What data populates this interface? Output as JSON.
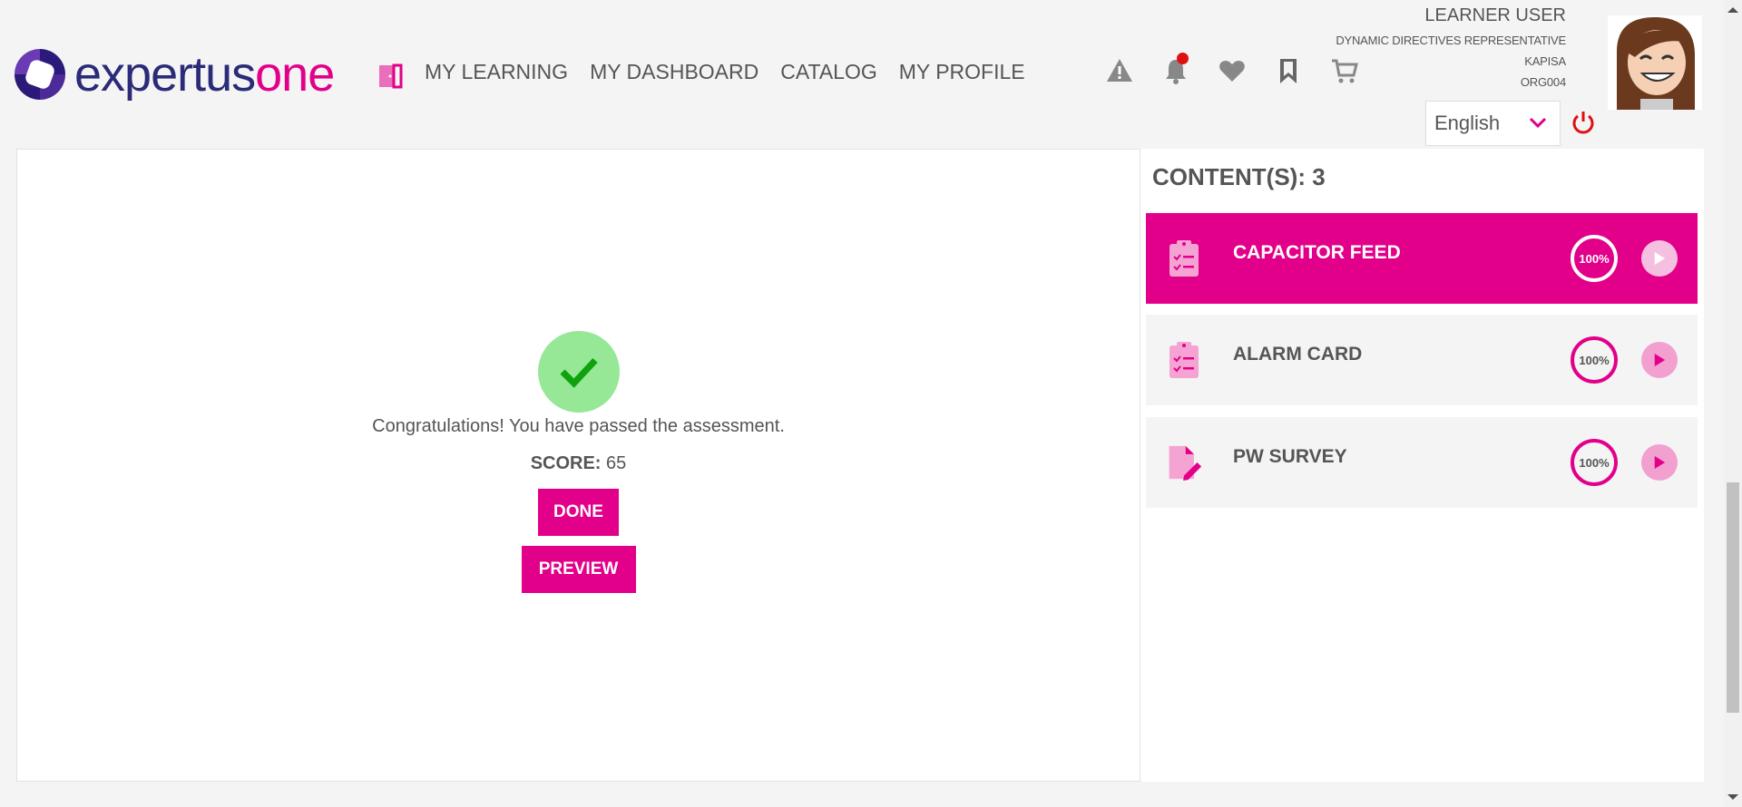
{
  "brand": {
    "logo_part1": "expertus",
    "logo_part2": "one",
    "accent_color": "#e2008a"
  },
  "nav": {
    "items": [
      {
        "label": "MY LEARNING"
      },
      {
        "label": "MY DASHBOARD"
      },
      {
        "label": "CATALOG"
      },
      {
        "label": "MY PROFILE"
      }
    ]
  },
  "header_icons": [
    "alert-icon",
    "bell-icon",
    "heart-icon",
    "bookmark-icon",
    "cart-icon"
  ],
  "user": {
    "name": "LEARNER USER",
    "role": "DYNAMIC DIRECTIVES REPRESENTATIVE",
    "org_name": "KAPISA",
    "org_code": "ORG004"
  },
  "language": {
    "selected": "English"
  },
  "assessment": {
    "message": "Congratulations! You have passed the assessment.",
    "score_label": "SCORE:",
    "score_value": "65",
    "done_label": "DONE",
    "preview_label": "PREVIEW"
  },
  "contents": {
    "heading": "CONTENT(S): 3",
    "items": [
      {
        "title": "CAPACITOR FEED",
        "progress": "100%",
        "icon": "clipboard-checklist-icon",
        "active": true
      },
      {
        "title": "ALARM CARD",
        "progress": "100%",
        "icon": "clipboard-checklist-icon",
        "active": false
      },
      {
        "title": "PW SURVEY",
        "progress": "100%",
        "icon": "document-edit-icon",
        "active": false
      }
    ]
  }
}
